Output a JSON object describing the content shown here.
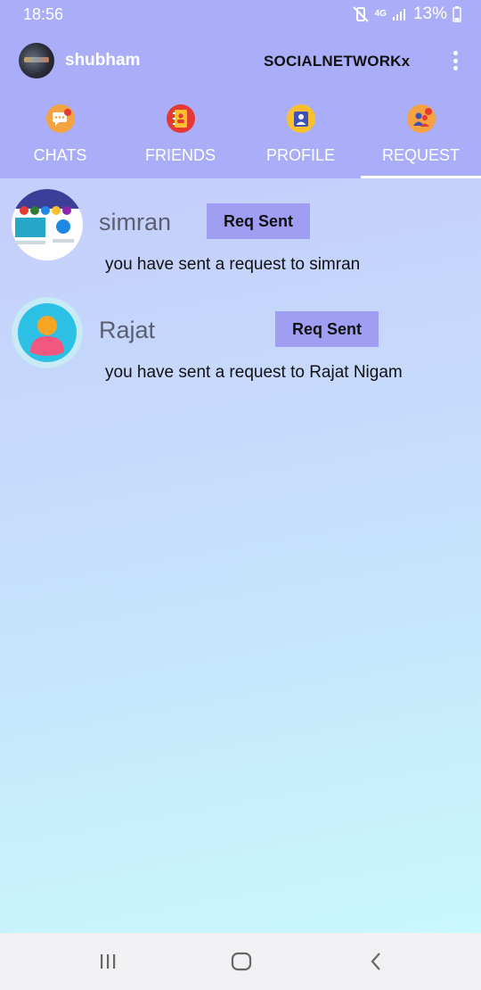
{
  "status_bar": {
    "time": "18:56",
    "battery": "13%",
    "network": "4G"
  },
  "header": {
    "username": "shubham",
    "app_title": "SOCIALNETWORKx",
    "menu_icon": "overflow-menu-icon"
  },
  "tabs": [
    {
      "label": "CHATS",
      "icon": "chat-bubble-icon",
      "active": false
    },
    {
      "label": "FRIENDS",
      "icon": "contacts-book-icon",
      "active": false
    },
    {
      "label": "PROFILE",
      "icon": "profile-card-icon",
      "active": false
    },
    {
      "label": "REQUEST",
      "icon": "friend-request-icon",
      "active": true
    }
  ],
  "requests": [
    {
      "name": "simran",
      "button_label": "Req Sent",
      "message": "you have sent a request to simran"
    },
    {
      "name": "Rajat",
      "button_label": "Req Sent",
      "message": "you have sent a request to Rajat Nigam"
    }
  ],
  "nav_bar": {
    "recents_icon": "recents-icon",
    "home_icon": "home-icon",
    "back_icon": "back-icon"
  },
  "colors": {
    "app_bar": "#aaaef9",
    "button": "#a09ef3",
    "background_top": "#c3c6fb",
    "background_bottom": "#c9fbfd"
  }
}
